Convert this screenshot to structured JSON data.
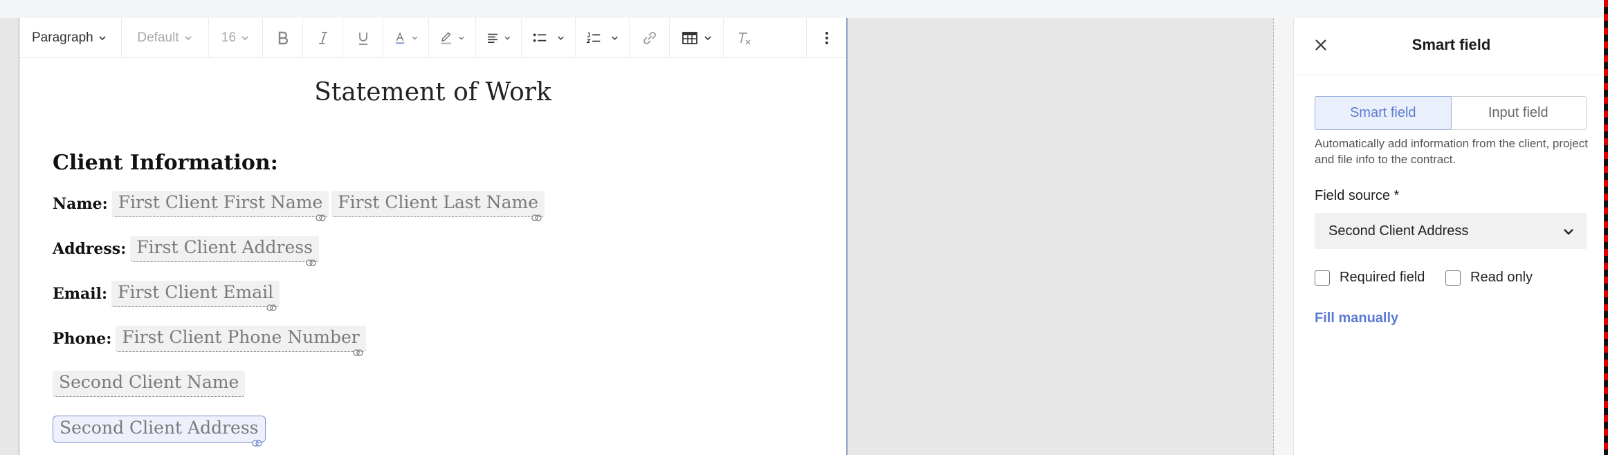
{
  "toolbar": {
    "block_style": "Paragraph",
    "font_family": "Default",
    "font_size": "16",
    "icons": [
      "bold-icon",
      "italic-icon",
      "underline-icon",
      "text-color-icon",
      "highlight-icon",
      "align-icon",
      "bullet-list-icon",
      "numbered-list-icon",
      "link-icon",
      "table-icon",
      "clear-format-icon",
      "more-icon"
    ]
  },
  "document": {
    "title": "Statement of Work",
    "section_heading": "Client Information:",
    "rows": [
      {
        "label": "Name:",
        "fields": [
          "First Client First Name",
          "First Client Last Name"
        ]
      },
      {
        "label": "Address:",
        "fields": [
          "First Client Address"
        ]
      },
      {
        "label": "Email:",
        "fields": [
          "First Client Email"
        ]
      },
      {
        "label": "Phone:",
        "fields": [
          "First Client Phone Number"
        ]
      },
      {
        "label": "",
        "fields": [
          "Second Client Name"
        ]
      },
      {
        "label": "",
        "fields": [
          "Second Client Address"
        ]
      }
    ]
  },
  "panel": {
    "title": "Smart field",
    "tabs": [
      "Smart field",
      "Input field"
    ],
    "active_tab": "Smart field",
    "description": "Automatically add information from the client, project and file info to the contract.",
    "field_source_label": "Field source *",
    "field_source_value": "Second Client Address",
    "required_label": "Required field",
    "readonly_label": "Read only",
    "fill_manually": "Fill manually"
  },
  "colors": {
    "accent": "#5a7bd4",
    "chip_bg": "#f1f1f1"
  }
}
